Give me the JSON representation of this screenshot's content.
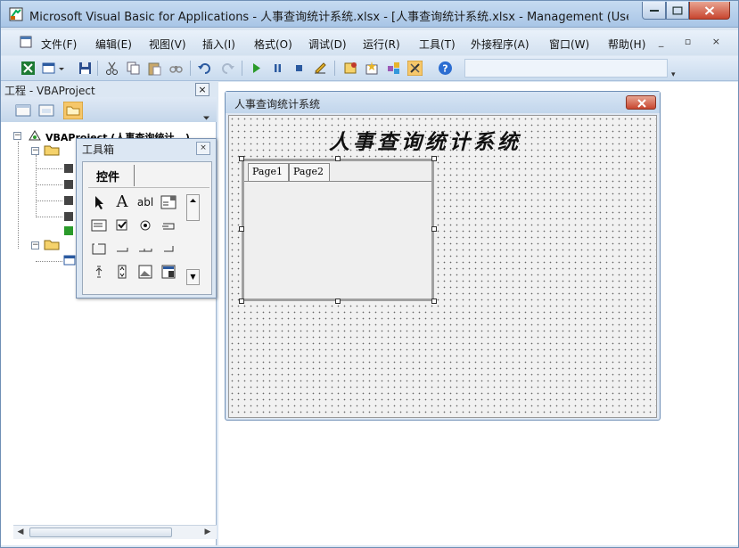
{
  "window": {
    "title": "Microsoft Visual Basic for Applications - 人事查询统计系统.xlsx - [人事查询统计系统.xlsx - Management (User..."
  },
  "menu": {
    "items": [
      "文件(F)",
      "编辑(E)",
      "视图(V)",
      "插入(I)",
      "格式(O)",
      "调试(D)",
      "运行(R)",
      "工具(T)",
      "外接程序(A)",
      "窗口(W)",
      "帮助(H)"
    ]
  },
  "toolbar": {
    "icons": [
      "excel-view-icon",
      "insert-userform-icon",
      "save-icon",
      "cut-icon",
      "copy-icon",
      "paste-icon",
      "find-icon",
      "undo-icon",
      "redo-icon",
      "run-icon",
      "break-icon",
      "reset-icon",
      "design-mode-icon",
      "project-explorer-icon",
      "properties-window-icon",
      "object-browser-icon",
      "toolbox-icon",
      "help-icon"
    ]
  },
  "project": {
    "title": "工程 - VBAProject",
    "close": "×",
    "root": "VBAProject (人事查询统计...)"
  },
  "toolbox": {
    "title": "工具箱",
    "close": "×",
    "tab": "控件",
    "tools": [
      "select-objects",
      "label",
      "textbox",
      "combobox",
      "listbox",
      "checkbox",
      "optionbutton",
      "togglebutton",
      "frame",
      "commandbutton",
      "tabstrip",
      "multipage",
      "scrollbar",
      "spinbutton",
      "image",
      "refedit"
    ]
  },
  "form": {
    "window_title": "人事查询统计系统",
    "heading": "人事查询统计系统",
    "tabs": [
      "Page1",
      "Page2"
    ]
  },
  "colors": {
    "accent": "#4a78b0",
    "close_red": "#c8462f",
    "run_green": "#2a9a2a"
  }
}
